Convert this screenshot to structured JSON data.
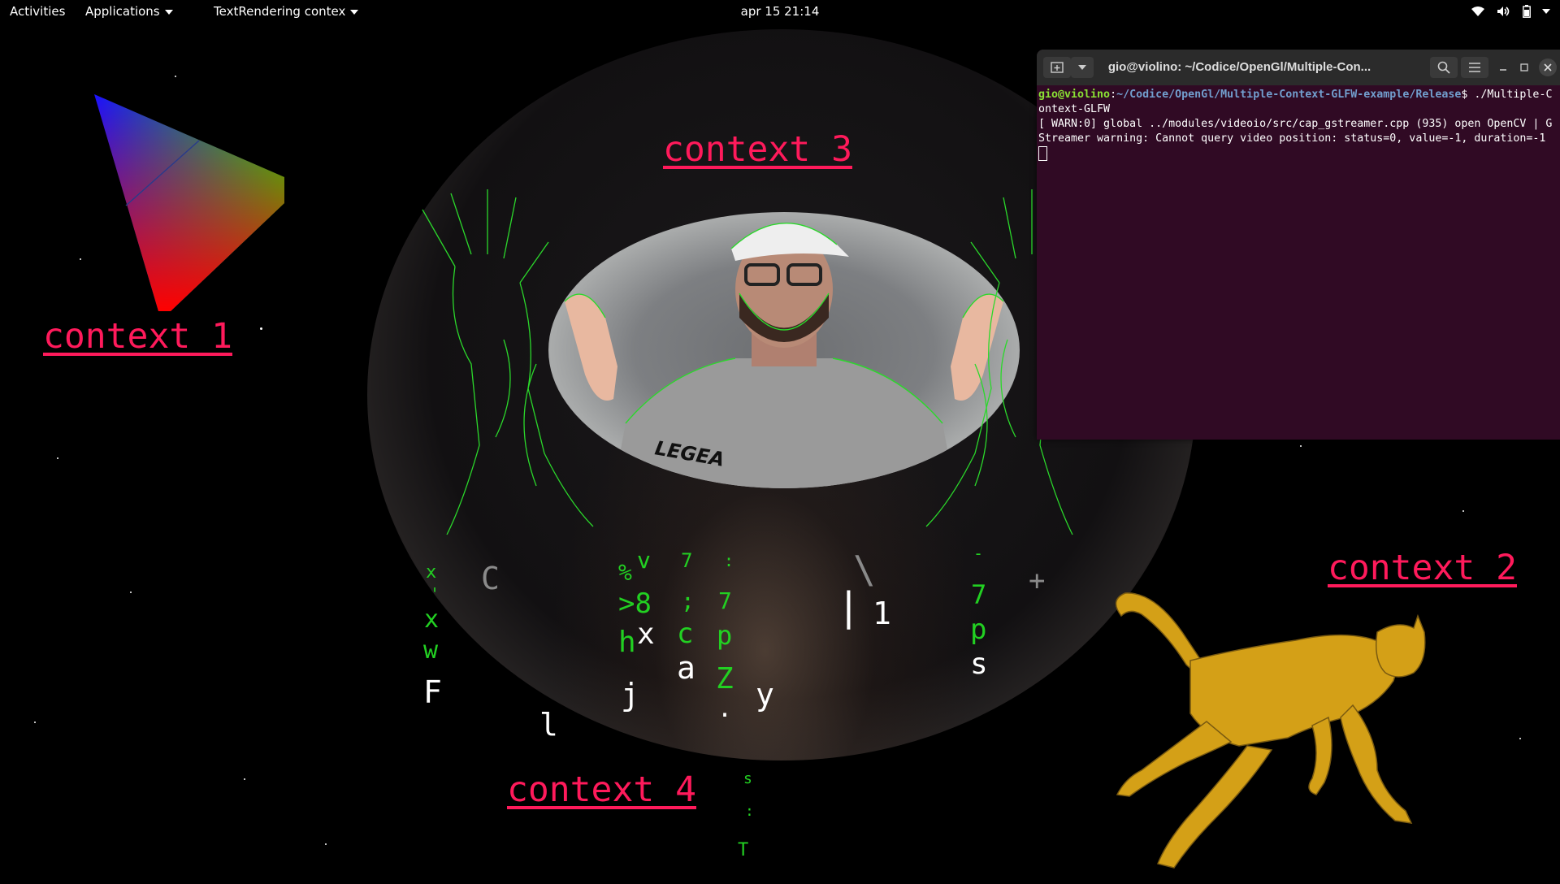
{
  "topbar": {
    "activities": "Activities",
    "applications": "Applications",
    "app_menu": "TextRendering contex",
    "clock": "apr 15  21:14",
    "tray_icons": [
      "wifi-icon",
      "volume-icon",
      "battery-icon",
      "system-menu-icon"
    ]
  },
  "contexts": {
    "ctx1": "context 1",
    "ctx2": "context 2",
    "ctx3": "context 3",
    "ctx4": "context 4"
  },
  "glyphs": {
    "g01": "x",
    "g02": "'",
    "g03": "x",
    "g04": "w",
    "g05": "F",
    "g06": "C",
    "g07": "l",
    "g08": "%",
    "g09": "v",
    "g10": ">8",
    "g11": "h",
    "g12": "x",
    "g13": "j",
    "g14": "7",
    "g15": ";",
    "g16": "c",
    "g17": "a",
    "g18": ":",
    "g19": "7",
    "g20": "p",
    "g21": "Z",
    "g22": ".",
    "g23": "y",
    "g24": "\\",
    "g25": "|",
    "g26": "1",
    "g27": "-",
    "g28": "7",
    "g29": "p",
    "g30": "s",
    "g31": "+",
    "g32": "s",
    "g33": ":",
    "g34": "T"
  },
  "colors": {
    "label": "#ff1a5b",
    "terminal_bg": "#300a24",
    "glyph_green": "#22d022",
    "contour_green": "#2bd82b",
    "lion": "#d4a017"
  },
  "terminal": {
    "title": "gio@violino: ~/Codice/OpenGl/Multiple-Con...",
    "prompt_user": "gio@violino",
    "prompt_sep": ":",
    "prompt_path": "~/Codice/OpenGl/Multiple-Context-GLFW-example/Release",
    "prompt_tail": "$ ./Multiple-Context-GLFW",
    "output": "[ WARN:0] global ../modules/videoio/src/cap_gstreamer.cpp (935) open OpenCV | GStreamer warning: Cannot query video position: status=0, value=-1, duration=-1"
  },
  "webcam": {
    "shirt_text": "LEGEA"
  }
}
